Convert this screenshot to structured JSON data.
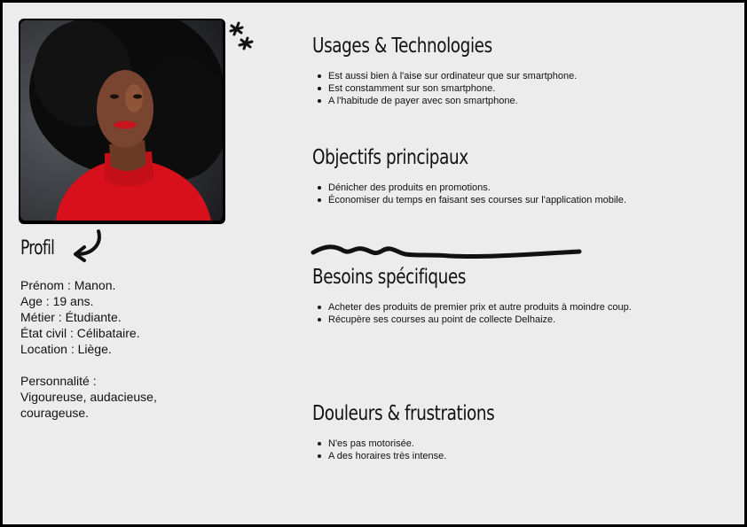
{
  "profile": {
    "title": "Profil",
    "lines": [
      "Prénom : Manon.",
      "Age : 19 ans.",
      "Métier : Étudiante.",
      "État civil : Célibataire.",
      "Location : Liège."
    ],
    "personality_label": "Personnalité :",
    "personality_lines": [
      "Vigoureuse, audacieuse,",
      "courageuse."
    ]
  },
  "sections": [
    {
      "title": "Usages & Technologies",
      "items": [
        "Est aussi bien à l'aise sur ordinateur que sur smartphone.",
        "Est constamment sur son smartphone.",
        "A l'habitude de payer avec son smartphone."
      ]
    },
    {
      "title": "Objectifs principaux",
      "items": [
        "Dénicher des produits en promotions.",
        "Économiser du temps en faisant ses courses sur l'application mobile."
      ]
    },
    {
      "title": "Besoins spécifiques",
      "items": [
        "Acheter des produits de premier prix et autre produits à moindre coup.",
        "Récupère ses courses au point de collecte Delhaize."
      ]
    },
    {
      "title": "Douleurs & frustrations",
      "items": [
        "N'es pas motorisée.",
        "A des horaires très intense."
      ]
    }
  ],
  "colors": {
    "background": "#ececec",
    "text": "#111111",
    "shirt": "#d8101c"
  }
}
